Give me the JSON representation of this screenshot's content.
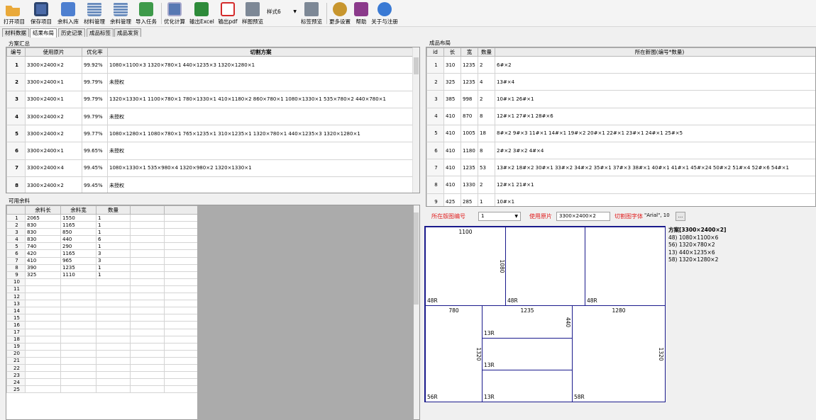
{
  "toolbar": {
    "buttons": [
      {
        "label": "打开项目",
        "icon": "open-folder-icon",
        "color": "#e9a93a"
      },
      {
        "label": "保存项目",
        "icon": "save-disk-icon",
        "color": "#4a6aa8"
      },
      {
        "label": "余料入库",
        "icon": "stock-in-icon",
        "color": "#4d7fd0"
      },
      {
        "label": "材料管理",
        "icon": "material-grid-icon",
        "color": "#6b8dbd"
      },
      {
        "label": "余料管理",
        "icon": "remnant-grid-icon",
        "color": "#6b8dbd"
      },
      {
        "label": "导入任务",
        "icon": "import-task-icon",
        "color": "#3e9a4a"
      },
      {
        "label": "优化计算",
        "icon": "calculator-icon",
        "color": "#5879b3"
      },
      {
        "label": "输出Excel",
        "icon": "excel-icon",
        "color": "#2e8b3a"
      },
      {
        "label": "输出pdf",
        "icon": "pdf-icon",
        "color": "#d42b2b"
      },
      {
        "label": "样图预览",
        "icon": "printer-icon",
        "color": "#7d8896"
      },
      {
        "label": "标签预览",
        "icon": "label-printer-icon",
        "color": "#7d8896"
      },
      {
        "label": "更多设置",
        "icon": "settings-tools-icon",
        "color": "#c8962e"
      },
      {
        "label": "帮助",
        "icon": "help-book-icon",
        "color": "#8b3a8b"
      },
      {
        "label": "关于与注册",
        "icon": "about-register-icon",
        "color": "#3a7ad4"
      }
    ],
    "style_select": "样式6"
  },
  "tabs": [
    "材料数据",
    "结果布局",
    "历史记录",
    "成品标签",
    "成品发货"
  ],
  "summary": {
    "title": "方案汇总",
    "headers": [
      "编号",
      "使用原片",
      "优化率",
      "切割方案"
    ],
    "rows": [
      [
        "1",
        "3300×2400×2",
        "99.92%",
        "1080×1100×3 1320×780×1 440×1235×3 1320×1280×1"
      ],
      [
        "2",
        "3300×2400×1",
        "99.79%",
        "未授权"
      ],
      [
        "3",
        "3300×2400×1",
        "99.79%",
        "1320×1330×1 1100×780×1 780×1330×1 410×1180×2 860×780×1 1080×1330×1 535×780×2 440×780×1"
      ],
      [
        "4",
        "3300×2400×2",
        "99.79%",
        "未授权"
      ],
      [
        "5",
        "3300×2400×2",
        "99.77%",
        "1080×1280×1 1080×780×1 765×1235×1 310×1235×1 1320×780×1 440×1235×3 1320×1280×1"
      ],
      [
        "6",
        "3300×2400×1",
        "99.65%",
        "未授权"
      ],
      [
        "7",
        "3300×2400×4",
        "99.45%",
        "1080×1330×1 535×980×4 1320×980×2 1320×1330×1"
      ],
      [
        "8",
        "3300×2400×2",
        "99.45%",
        "未授权"
      ]
    ]
  },
  "products": {
    "title": "成品布局",
    "headers": [
      "id",
      "长",
      "宽",
      "数量",
      "所在新图(编号*数量)"
    ],
    "rows": [
      [
        "1",
        "310",
        "1235",
        "2",
        "6#×2"
      ],
      [
        "2",
        "325",
        "1235",
        "4",
        "13#×4"
      ],
      [
        "3",
        "385",
        "998",
        "2",
        "10#×1 26#×1"
      ],
      [
        "4",
        "410",
        "870",
        "8",
        "12#×1 27#×1 28#×6"
      ],
      [
        "5",
        "410",
        "1005",
        "18",
        "8#×2 9#×3 11#×1 14#×1 19#×2 20#×1 22#×1 23#×1 24#×1 25#×5"
      ],
      [
        "6",
        "410",
        "1180",
        "8",
        "2#×2 3#×2 4#×4"
      ],
      [
        "7",
        "410",
        "1235",
        "53",
        "13#×2 18#×2 30#×1 33#×2 34#×2 35#×1 37#×3 38#×1 40#×1 41#×1 45#×24 50#×2 51#×4 52#×6 54#×1"
      ],
      [
        "8",
        "410",
        "1330",
        "2",
        "12#×1 21#×1"
      ],
      [
        "9",
        "425",
        "285",
        "1",
        "10#×1"
      ]
    ]
  },
  "remnants": {
    "title": "可用余料",
    "headers": [
      "余料长",
      "余料宽",
      "数量"
    ],
    "rows": [
      [
        "1",
        "2065",
        "1550",
        "1"
      ],
      [
        "2",
        "830",
        "1165",
        "1"
      ],
      [
        "3",
        "830",
        "850",
        "1"
      ],
      [
        "4",
        "830",
        "440",
        "6"
      ],
      [
        "5",
        "740",
        "290",
        "1"
      ],
      [
        "6",
        "420",
        "1165",
        "3"
      ],
      [
        "7",
        "410",
        "965",
        "3"
      ],
      [
        "8",
        "390",
        "1235",
        "1"
      ],
      [
        "9",
        "325",
        "1110",
        "1"
      ],
      [
        "10",
        "",
        "",
        ""
      ],
      [
        "11",
        "",
        "",
        ""
      ],
      [
        "12",
        "",
        "",
        ""
      ],
      [
        "13",
        "",
        "",
        ""
      ],
      [
        "14",
        "",
        "",
        ""
      ],
      [
        "15",
        "",
        "",
        ""
      ],
      [
        "16",
        "",
        "",
        ""
      ],
      [
        "17",
        "",
        "",
        ""
      ],
      [
        "18",
        "",
        "",
        ""
      ],
      [
        "19",
        "",
        "",
        ""
      ],
      [
        "20",
        "",
        "",
        ""
      ],
      [
        "21",
        "",
        "",
        ""
      ],
      [
        "22",
        "",
        "",
        ""
      ],
      [
        "23",
        "",
        "",
        ""
      ],
      [
        "24",
        "",
        "",
        ""
      ],
      [
        "25",
        "",
        "",
        ""
      ]
    ]
  },
  "controls": {
    "layout_no_label": "所在版图编号",
    "layout_no_value": "1",
    "sheet_label": "使用原片",
    "sheet_value": "3300×2400×2",
    "font_label": "切割图字体",
    "font_value": "\"Arial\", 10",
    "font_button": "..."
  },
  "layout": {
    "pieces": [
      {
        "w": "1100",
        "h": "",
        "id": "48R"
      },
      {
        "w": "",
        "h": "1080",
        "id": "48R"
      },
      {
        "w": "",
        "h": "",
        "id": "48R"
      },
      {
        "w": "780",
        "h": "",
        "id": "56R"
      },
      {
        "w": "1235",
        "h": "440",
        "id": "13R"
      },
      {
        "w": "",
        "h": "1320",
        "id": "13R"
      },
      {
        "w": "",
        "h": "",
        "id": "13R"
      },
      {
        "w": "1280",
        "h": "1320",
        "id": "58R"
      }
    ]
  },
  "legend": {
    "title": "方案[3300×2400×2]",
    "items": [
      "48) 1080×1100×6",
      "56) 1320×780×2",
      "13) 440×1235×6",
      "58) 1320×1280×2"
    ]
  }
}
